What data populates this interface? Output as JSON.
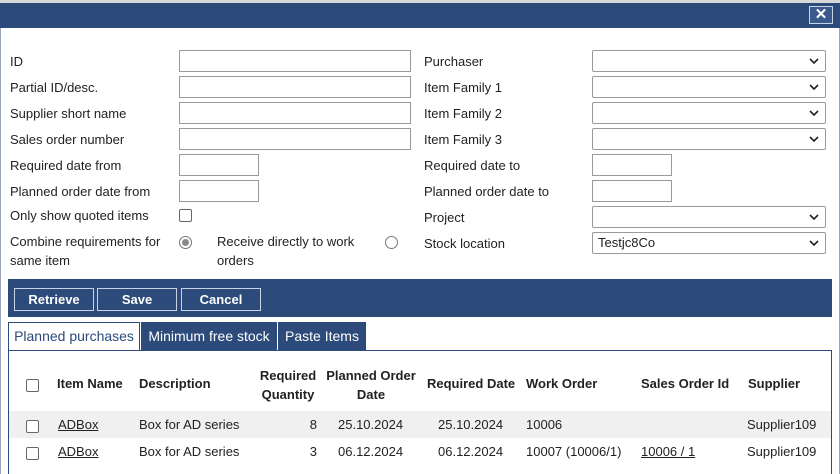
{
  "window": {
    "close_label": "✕"
  },
  "form": {
    "id_label": "ID",
    "partial_id_label": "Partial ID/desc.",
    "supplier_short_name_label": "Supplier short name",
    "sales_order_number_label": "Sales order number",
    "required_date_from_label": "Required date from",
    "planned_order_date_from_label": "Planned order date from",
    "only_show_quoted_label": "Only show quoted items",
    "combine_requirements_label_1": "Combine requirements for",
    "combine_requirements_label_2": "same item",
    "receive_directly_label_1": "Receive directly to work",
    "receive_directly_label_2": "orders",
    "purchaser_label": "Purchaser",
    "item_family_1_label": "Item Family 1",
    "item_family_2_label": "Item Family 2",
    "item_family_3_label": "Item Family 3",
    "required_date_to_label": "Required date to",
    "planned_order_date_to_label": "Planned order date to",
    "project_label": "Project",
    "stock_location_label": "Stock location",
    "stock_location_value": "Testjc8Co",
    "only_show_quoted": false,
    "combine_requirements": true,
    "receive_directly": false
  },
  "toolbar": {
    "retrieve_label": "Retrieve",
    "save_label": "Save",
    "cancel_label": "Cancel"
  },
  "tabs": [
    {
      "label": "Planned purchases",
      "active": true
    },
    {
      "label": "Minimum free stock",
      "active": false
    },
    {
      "label": "Paste Items",
      "active": false
    }
  ],
  "table": {
    "headers": {
      "item_name": "Item Name",
      "description": "Description",
      "required_quantity_1": "Required",
      "required_quantity_2": "Quantity",
      "planned_order_date_1": "Planned Order",
      "planned_order_date_2": "Date",
      "required_date": "Required Date",
      "work_order": "Work Order",
      "sales_order_id": "Sales Order Id",
      "supplier": "Supplier"
    },
    "rows": [
      {
        "item_name": "ADBox",
        "description": "Box for AD series",
        "quantity": "8",
        "planned_order_date": "25.10.2024",
        "required_date": "25.10.2024",
        "work_order": "10006",
        "sales_order_id": "",
        "supplier": "Supplier109"
      },
      {
        "item_name": "ADBox",
        "description": "Box for AD series",
        "quantity": "3",
        "planned_order_date": "06.12.2024",
        "required_date": "06.12.2024",
        "work_order": "10007 (10006/1)",
        "sales_order_id": "10006 / 1",
        "supplier": "Supplier109"
      }
    ]
  }
}
